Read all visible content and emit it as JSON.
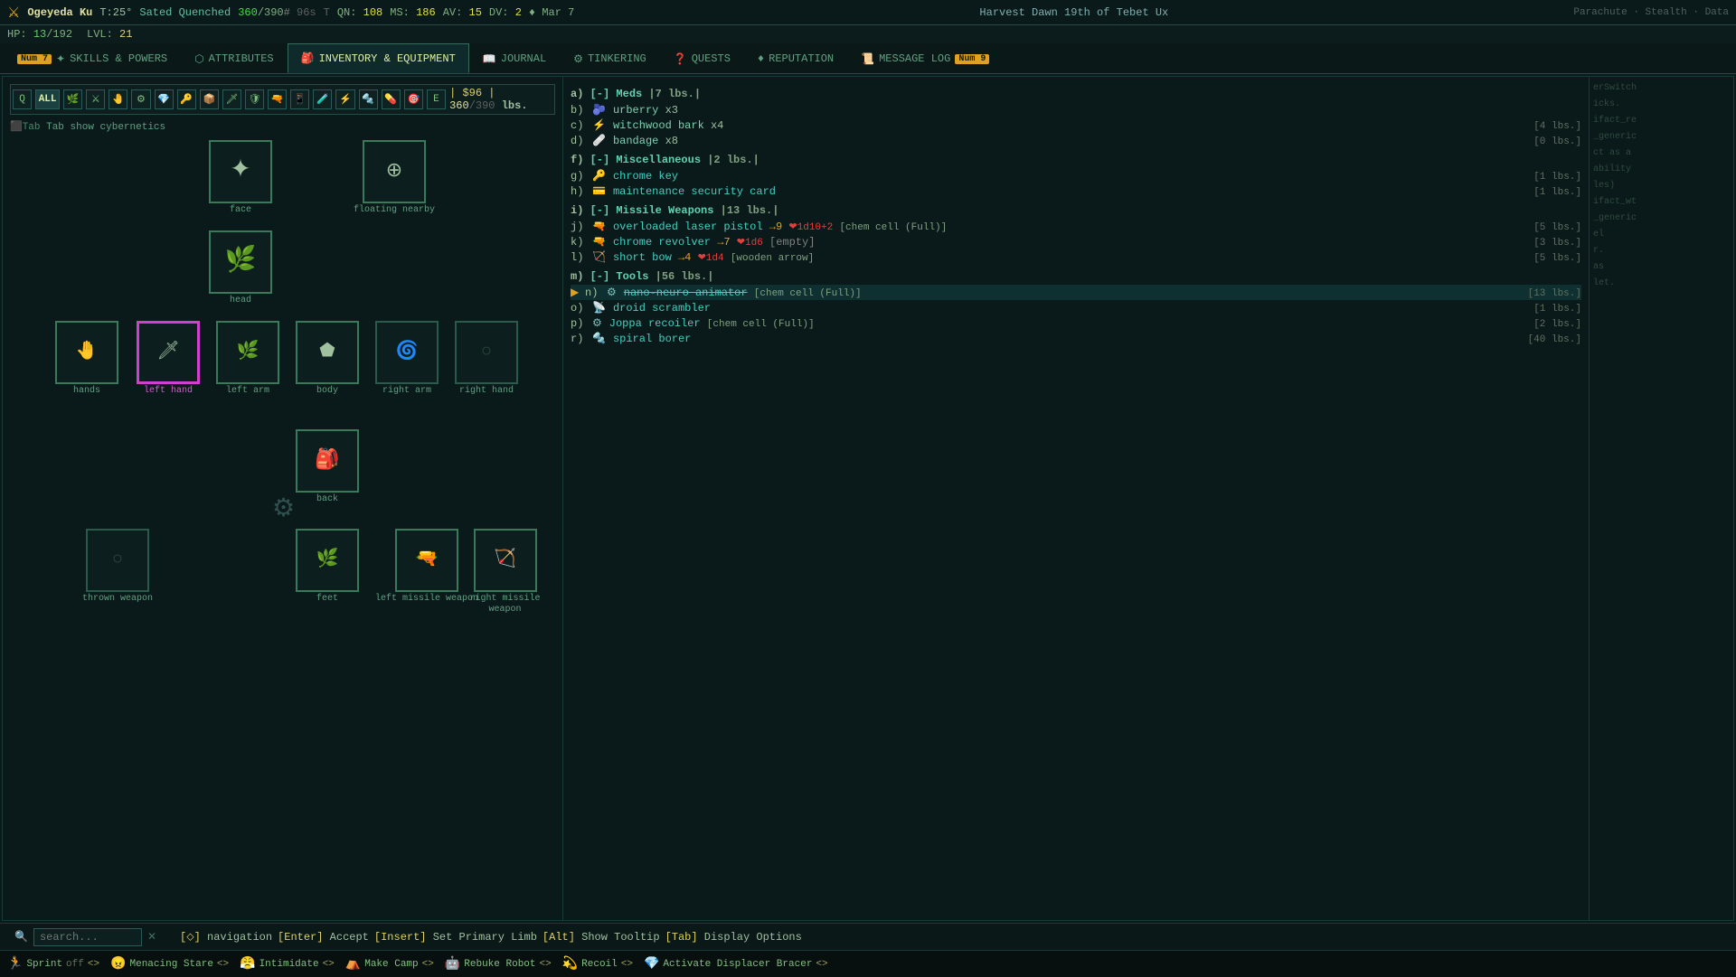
{
  "topbar": {
    "char_name": "Ogeyeda Ku",
    "title": "T:25°",
    "status": "Sated Quenched",
    "hp_current": "360",
    "hp_max": "390",
    "hp_symbol": "#",
    "weight": "96s",
    "qn": "108",
    "ms": "186",
    "av": "15",
    "dv": "2",
    "mood": "Mar 7",
    "date_full": "Harvest Dawn 19th of Tebet Ux",
    "right_info": "Parachute · Stealth · Data"
  },
  "hp_bar": {
    "hp_label": "HP:",
    "hp_val": "13",
    "hp_max": "192",
    "lvl_label": "LVL:",
    "lvl_val": "21"
  },
  "nav": {
    "tabs": [
      {
        "id": "skills",
        "label": "SKILLS & POWERS",
        "badge": "7",
        "active": false
      },
      {
        "id": "attributes",
        "label": "ATTRIBUTES",
        "badge": "",
        "active": false
      },
      {
        "id": "inventory",
        "label": "INVENTORY & EQUIPMENT",
        "badge": "",
        "active": true
      },
      {
        "id": "journal",
        "label": "JOURNAL",
        "badge": "",
        "active": false
      },
      {
        "id": "tinkering",
        "label": "TINKERING",
        "badge": "",
        "active": false
      },
      {
        "id": "quests",
        "label": "QUESTS",
        "badge": "",
        "active": false
      },
      {
        "id": "reputation",
        "label": "REPUTATION",
        "badge": "",
        "active": false
      },
      {
        "id": "messagelog",
        "label": "MESSAGE LOG",
        "badge": "9",
        "active": false
      }
    ]
  },
  "filter": {
    "money": "$96",
    "weight_cur": "360",
    "weight_max": "390",
    "weight_unit": "lbs."
  },
  "cybernetics_toggle": "Tab show cybernetics",
  "slots": {
    "face": {
      "label": "face",
      "has_item": true
    },
    "floating_nearby": {
      "label": "floating nearby",
      "has_item": true
    },
    "head": {
      "label": "head",
      "has_item": true
    },
    "hands": {
      "label": "hands",
      "has_item": true
    },
    "left_hand": {
      "label": "left hand",
      "has_item": true,
      "highlighted": true
    },
    "left_arm": {
      "label": "left arm",
      "has_item": true
    },
    "body": {
      "label": "body",
      "has_item": true
    },
    "right_arm": {
      "label": "right arm",
      "has_item": true
    },
    "right_hand": {
      "label": "right hand",
      "has_item": false
    },
    "back": {
      "label": "back",
      "has_item": true
    },
    "thrown_weapon": {
      "label": "thrown weapon",
      "has_item": false
    },
    "feet": {
      "label": "feet",
      "has_item": true
    },
    "left_missile_weapon": {
      "label": "left missile weapon",
      "has_item": true
    },
    "right_missile_weapon": {
      "label": "right missile weapon",
      "has_item": true
    }
  },
  "inventory": {
    "sections": [
      {
        "id": "meds",
        "header": "a)  [-] Meds  |7 lbs.|",
        "items": [
          {
            "key": "b)",
            "icon": "🫐",
            "name": "urberry",
            "qty": "x3",
            "weight": ""
          },
          {
            "key": "c)",
            "icon": "⚡",
            "name": "witchwood bark",
            "qty": "x4",
            "weight": "[4 lbs.]"
          },
          {
            "key": "d)",
            "icon": "🩹",
            "name": "bandage",
            "qty": "x8",
            "weight": "[0 lbs.]"
          }
        ]
      },
      {
        "id": "misc",
        "header": "f)  [-] Miscellaneous  |2 lbs.|",
        "items": [
          {
            "key": "g)",
            "icon": "🔑",
            "name": "chrome key",
            "qty": "",
            "weight": "[1 lbs.]"
          },
          {
            "key": "h)",
            "icon": "💳",
            "name": "maintenance security card",
            "qty": "",
            "weight": "[1 lbs.]"
          }
        ]
      },
      {
        "id": "missile",
        "header": "i)  [-] Missile Weapons  |13 lbs.|",
        "items": [
          {
            "key": "j)",
            "icon": "🔫",
            "name": "overloaded laser pistol",
            "arrow": "→9",
            "dmg": "❤1d10+2",
            "extra": "[chem cell (Full)]",
            "weight": "[5 lbs.]"
          },
          {
            "key": "k)",
            "icon": "🔫",
            "name": "chrome revolver",
            "arrow": "→7",
            "dmg": "❤1d6",
            "extra": "[empty]",
            "weight": "[3 lbs.]"
          },
          {
            "key": "l)",
            "icon": "🏹",
            "name": "short bow",
            "arrow": "→4",
            "dmg": "❤1d4",
            "extra": "[wooden arrow]",
            "weight": "[5 lbs.]"
          }
        ]
      },
      {
        "id": "tools",
        "header": "m)  [-] Tools  |56 lbs.|",
        "items": [
          {
            "key": "n)",
            "icon": "⚙",
            "name": "nano-neuro animator",
            "extra": "[chem cell (Full)]",
            "weight": "[13 lbs.]",
            "selected": true
          },
          {
            "key": "o)",
            "icon": "📡",
            "name": "droid scrambler",
            "extra": "",
            "weight": "[1 lbs.]"
          },
          {
            "key": "p)",
            "icon": "⚙",
            "name": "Joppa recoiler",
            "extra": "[chem cell (Full)]",
            "weight": "[2 lbs.]"
          },
          {
            "key": "r)",
            "icon": "🔩",
            "name": "spiral borer",
            "extra": "",
            "weight": "[40 lbs.]"
          }
        ]
      }
    ]
  },
  "bottom_bar": {
    "search_placeholder": "search...",
    "keybinds": [
      {
        "key": "[⬦]",
        "action": "navigation"
      },
      {
        "key": "[Enter]",
        "action": "Accept"
      },
      {
        "key": "[Insert]",
        "action": "Set Primary Limb"
      },
      {
        "key": "[Alt]",
        "action": "Show Tooltip"
      },
      {
        "key": "[Tab]",
        "action": "Display Options"
      }
    ]
  },
  "abilities_bar": {
    "abilities": [
      {
        "icon": "🏃",
        "name": "Sprint",
        "state": "off",
        "key": "<>"
      },
      {
        "icon": "😠",
        "name": "Menacing Stare",
        "key": "<>"
      },
      {
        "icon": "😤",
        "name": "Intimidate",
        "key": "<>"
      },
      {
        "icon": "⛺",
        "name": "Make Camp",
        "key": "<>"
      },
      {
        "icon": "🤖",
        "name": "Rebuke Robot",
        "key": "<>"
      },
      {
        "icon": "💫",
        "name": "Recoil",
        "key": "<>"
      },
      {
        "icon": "💎",
        "name": "Activate Displacer Bracer",
        "key": "<>"
      }
    ]
  },
  "right_sidebar": {
    "hints": [
      "erSwitch",
      "icks.",
      "ifact_re",
      "_generic",
      "ct as a",
      "ability",
      "les)",
      "ifact_wt",
      "_generic",
      "el",
      "r.",
      "as",
      "let."
    ]
  }
}
